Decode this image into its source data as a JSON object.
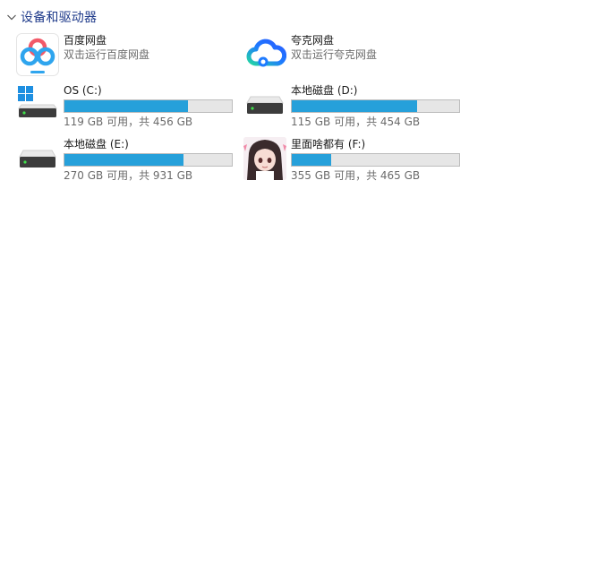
{
  "section": {
    "title": "设备和驱动器"
  },
  "cloud_items": [
    {
      "name": "百度网盘",
      "subtitle": "双击运行百度网盘",
      "icon": "baidu-netdisk-icon"
    },
    {
      "name": "夸克网盘",
      "subtitle": "双击运行夸克网盘",
      "icon": "quark-netdisk-icon"
    }
  ],
  "drives": [
    {
      "name": "OS (C:)",
      "free_text": "119 GB 可用，共 456 GB",
      "free_gb": 119,
      "total_gb": 456,
      "used_fraction": 0.739,
      "icon": "windows-drive-icon"
    },
    {
      "name": "本地磁盘 (D:)",
      "free_text": "115 GB 可用，共 454 GB",
      "free_gb": 115,
      "total_gb": 454,
      "used_fraction": 0.747,
      "icon": "hard-drive-icon"
    },
    {
      "name": "本地磁盘 (E:)",
      "free_text": "270 GB 可用，共 931 GB",
      "free_gb": 270,
      "total_gb": 931,
      "used_fraction": 0.71,
      "icon": "hard-drive-icon"
    },
    {
      "name": "里面啥都有 (F:)",
      "free_text": "355 GB 可用，共 465 GB",
      "free_gb": 355,
      "total_gb": 465,
      "used_fraction": 0.237,
      "icon": "custom-drive-avatar-icon"
    }
  ],
  "colors": {
    "bar_fill": "#26a0da",
    "bar_track": "#e6e6e6",
    "header_text": "#1e3a8a"
  }
}
